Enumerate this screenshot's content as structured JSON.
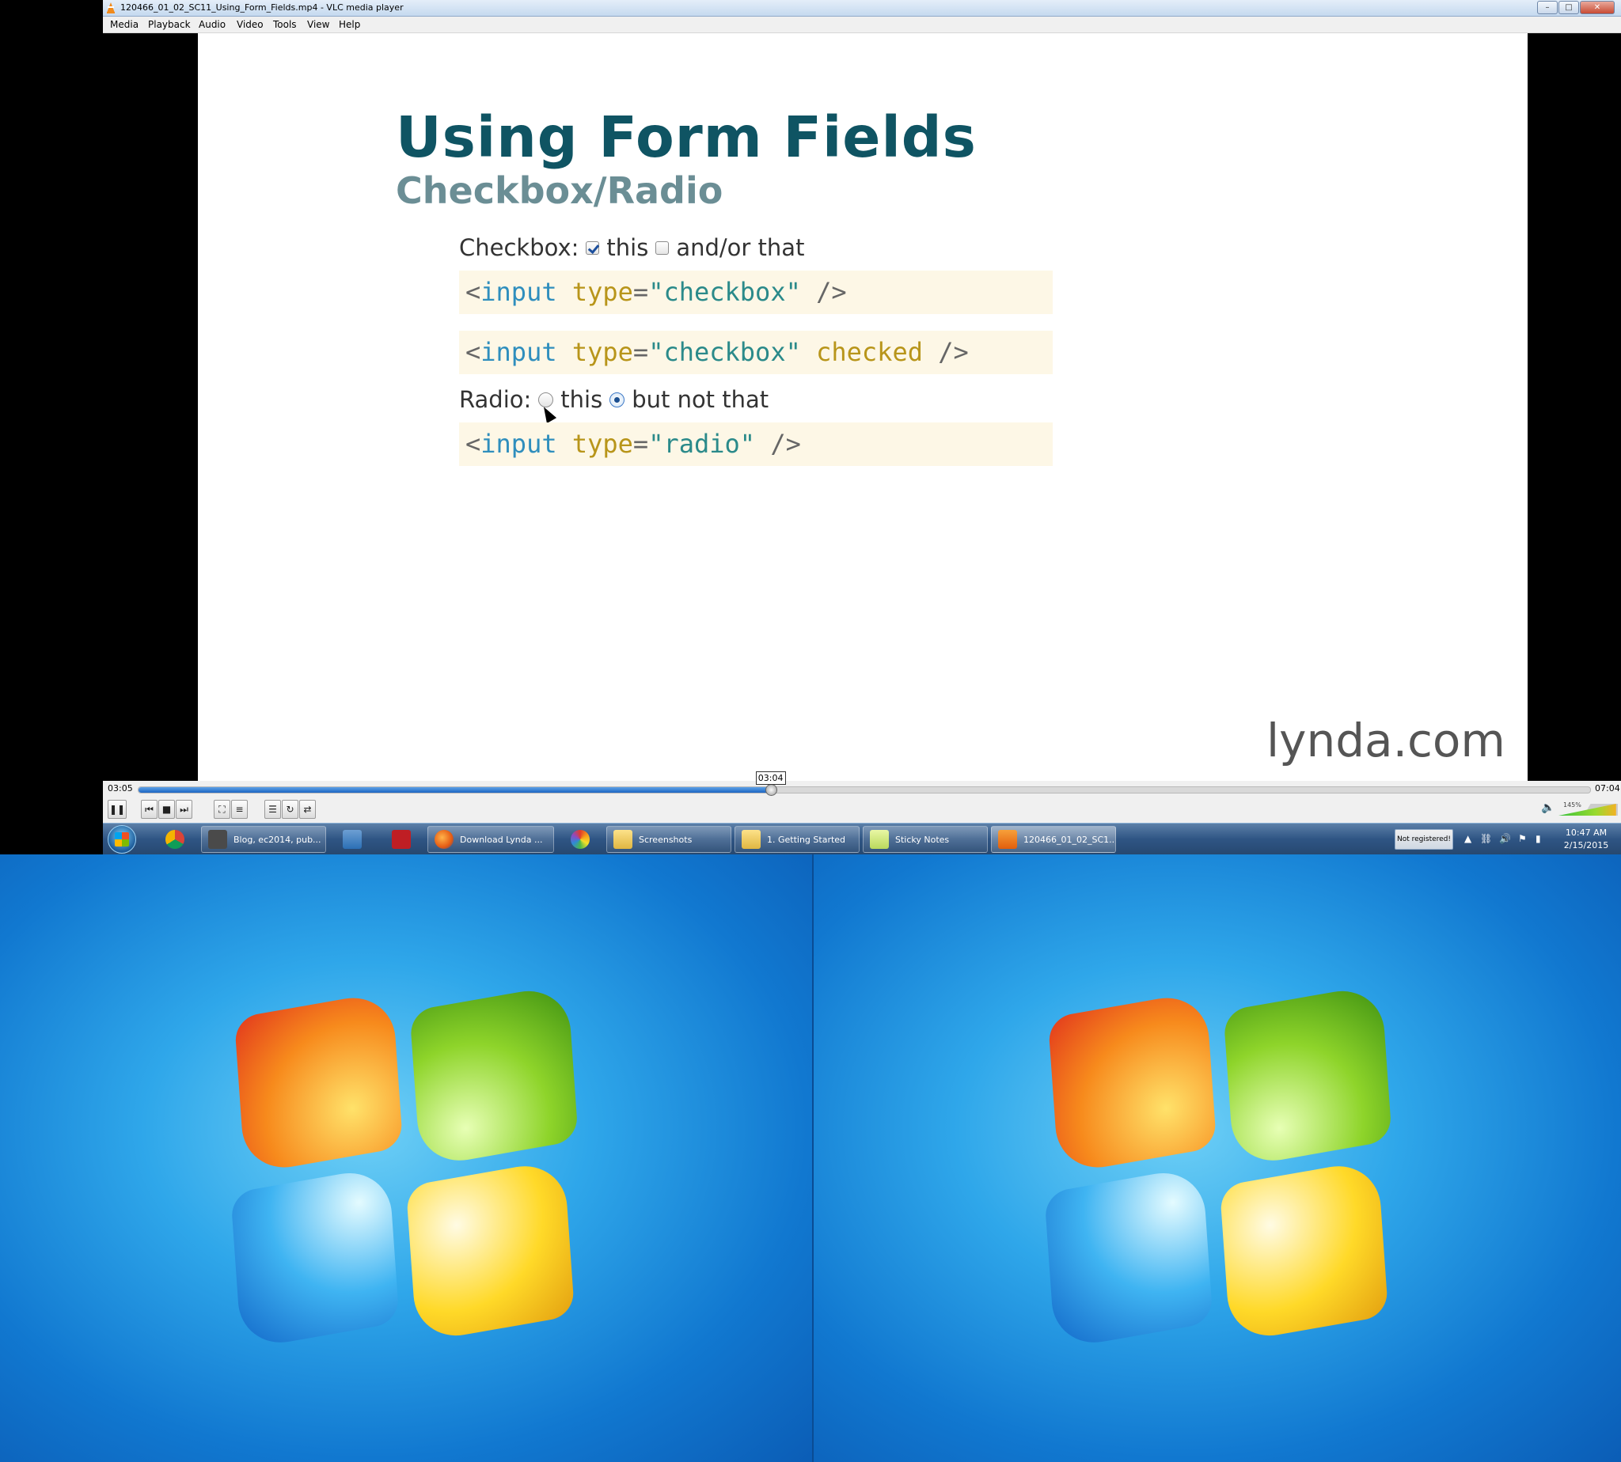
{
  "window": {
    "title": "120466_01_02_SC11_Using_Form_Fields.mp4 - VLC media player"
  },
  "menu": [
    "Media",
    "Playback",
    "Audio",
    "Video",
    "Tools",
    "View",
    "Help"
  ],
  "slide": {
    "title": "Using Form Fields",
    "subtitle": "Checkbox/Radio",
    "checkbox_label": "Checkbox:",
    "checkbox_opt1": "this",
    "checkbox_opt2": "and/or that",
    "checkbox_opt1_checked": true,
    "checkbox_opt2_checked": false,
    "radio_label": "Radio:",
    "radio_opt1": "this",
    "radio_opt2": "but not that",
    "radio_selected": "but not that",
    "code1": {
      "lt": "<",
      "tag": "input",
      "attr": "type",
      "eq": "=",
      "val": "\"checkbox\"",
      "end": " />"
    },
    "code2": {
      "lt": "<",
      "tag": "input",
      "attr": "type",
      "eq": "=",
      "val": "\"checkbox\"",
      "extra": "checked",
      "end": " />"
    },
    "code3": {
      "lt": "<",
      "tag": "input",
      "attr": "type",
      "eq": "=",
      "val": "\"radio\"",
      "end": " />"
    },
    "brand": "lynda",
    "brand_tld": ".com"
  },
  "player": {
    "elapsed": "03:05",
    "total": "07:04",
    "hover_time": "03:04",
    "progress": 0.436,
    "volume_label": "145%",
    "volume_level": 0.97
  },
  "taskbar": {
    "items": [
      {
        "label": "Blog, ec2014, pub...",
        "icon": "sublime-icon"
      },
      {
        "label": "Download Lynda ...",
        "icon": "firefox-icon"
      },
      {
        "label": "Screenshots",
        "icon": "folder-icon"
      },
      {
        "label": "1. Getting Started",
        "icon": "folder-icon"
      },
      {
        "label": "Sticky Notes",
        "icon": "sticky-notes-icon"
      },
      {
        "label": "120466_01_02_SC1...",
        "icon": "vlc-icon"
      }
    ],
    "not_registered": "Not registered!",
    "time": "10:47 AM",
    "date": "2/15/2015"
  },
  "colors": {
    "accent": "#1c66c4",
    "slide_title": "#0f5463",
    "slide_sub": "#6b8e95",
    "code_bg": "#fdf7e6"
  }
}
